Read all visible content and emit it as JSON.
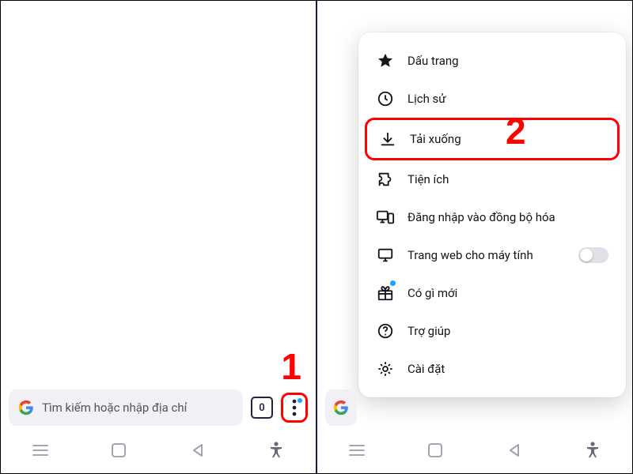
{
  "urlbar": {
    "placeholder": "Tìm kiếm hoặc nhập địa chỉ",
    "tabs_count": "0"
  },
  "menu": {
    "items": [
      {
        "label": "Dấu trang"
      },
      {
        "label": "Lịch sử"
      },
      {
        "label": "Tải xuống"
      },
      {
        "label": "Tiện ích"
      },
      {
        "label": "Đăng nhập vào đồng bộ hóa"
      },
      {
        "label": "Trang web cho máy tính"
      },
      {
        "label": "Có gì mới"
      },
      {
        "label": "Trợ giúp"
      },
      {
        "label": "Cài đặt"
      }
    ]
  },
  "annotations": {
    "step1": "1",
    "step2": "2"
  }
}
